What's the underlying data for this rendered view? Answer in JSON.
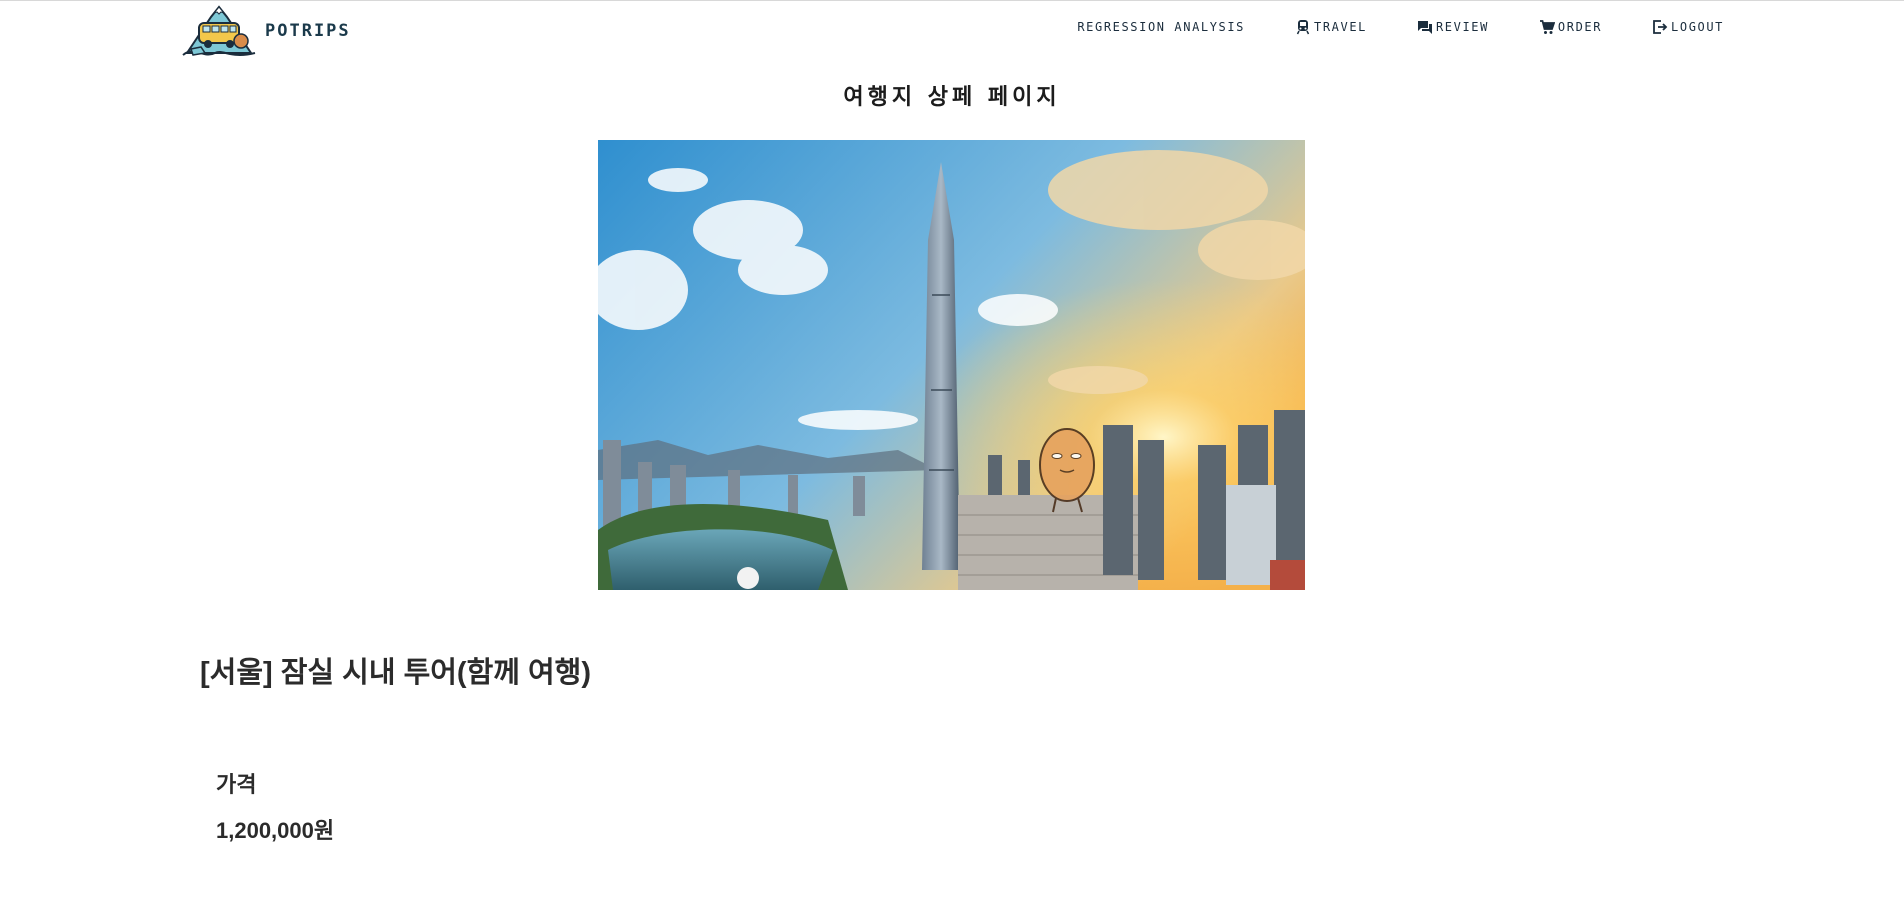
{
  "brand": {
    "name": "POTRIPS",
    "logo_icon": "bus-mountain-logo"
  },
  "nav": {
    "items": [
      {
        "label": "REGRESSION ANALYSIS",
        "icon": ""
      },
      {
        "label": "TRAVEL",
        "icon": "train-icon"
      },
      {
        "label": "REVIEW",
        "icon": "chat-icon"
      },
      {
        "label": "ORDER",
        "icon": "cart-icon"
      },
      {
        "label": "LOGOUT",
        "icon": "logout-icon"
      }
    ]
  },
  "page": {
    "heading": "여행지 상페 페이지"
  },
  "product": {
    "title": "[서울] 잠실 시내 투어(함께 여행)",
    "price_label": "가격",
    "price_value": "1,200,000원"
  },
  "colors": {
    "nav_text": "#1b2d3d",
    "brand_text": "#1b3a4b",
    "heading": "#1c1c1c",
    "body_text": "#2b2b2b"
  }
}
